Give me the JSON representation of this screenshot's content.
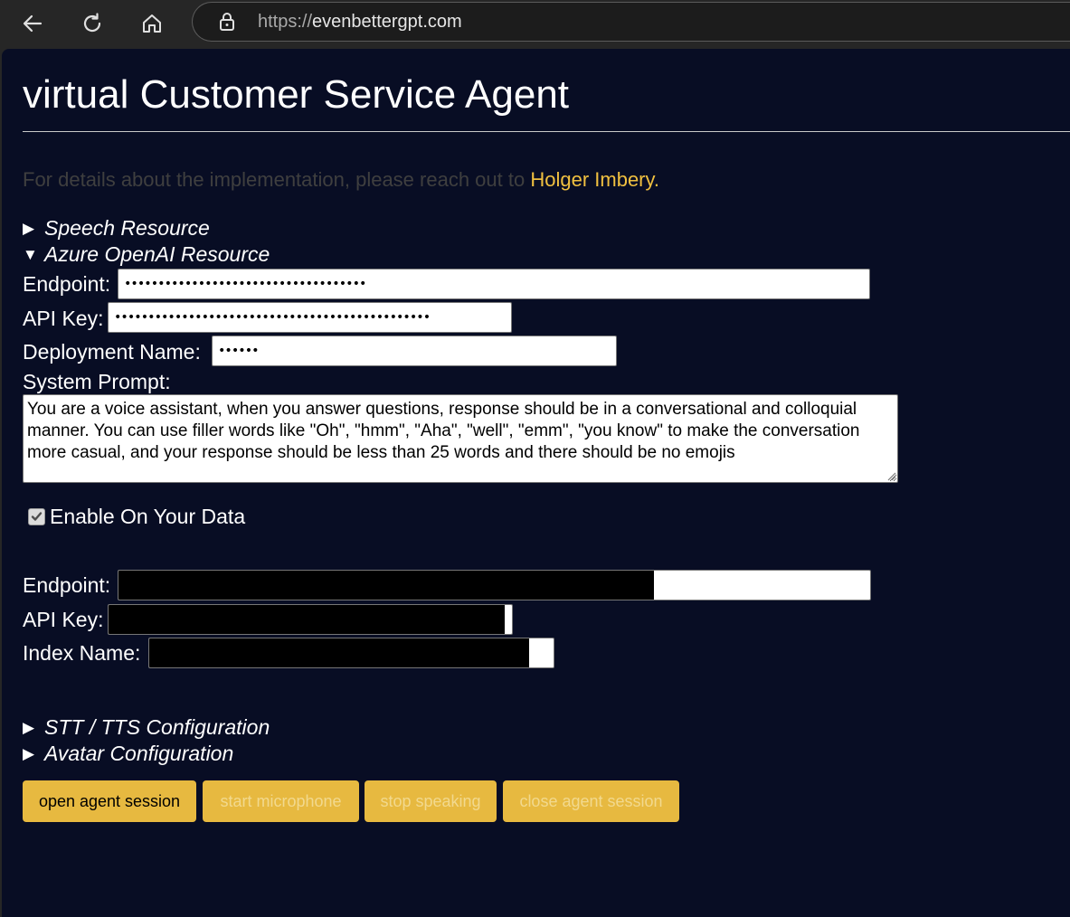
{
  "browser": {
    "url_scheme": "https://",
    "url_host": "evenbettergpt.com"
  },
  "page": {
    "title": "virtual Customer Service Agent",
    "info_text": "For details about the implementation, please reach out to ",
    "info_link": "Holger Imbery."
  },
  "sections": {
    "speech": {
      "label": "Speech Resource",
      "expanded": false
    },
    "azure_openai": {
      "label": "Azure OpenAI Resource",
      "expanded": true
    },
    "stt_tts": {
      "label": "STT / TTS Configuration",
      "expanded": false
    },
    "avatar": {
      "label": "Avatar Configuration",
      "expanded": false
    }
  },
  "azure_openai": {
    "endpoint_label": "Endpoint:",
    "endpoint_value": "••••••••••••••••••••••••••••••••••••",
    "api_key_label": "API Key:",
    "api_key_value": "•••••••••••••••••••••••••••••••••••••••••••••••",
    "deployment_label": "Deployment Name:",
    "deployment_value": "••••••",
    "system_prompt_label": "System Prompt:",
    "system_prompt_value": "You are a voice assistant, when you answer questions, response should be in a conversational and colloquial manner. You can use filler words like \"Oh\", \"hmm\", \"Aha\", \"well\", \"emm\", \"you know\" to make the conversation more casual, and your response should be less than 25 words and there should be no emojis"
  },
  "on_your_data": {
    "checkbox_label": "Enable On Your Data",
    "checked": true,
    "endpoint_label": "Endpoint:",
    "api_key_label": "API Key:",
    "index_label": "Index Name:"
  },
  "buttons": {
    "open_session": "open agent session",
    "start_mic": "start microphone",
    "stop_speaking": "stop speaking",
    "close_session": "close agent session"
  },
  "colors": {
    "page_bg": "#080d24",
    "accent": "#e7b940",
    "link": "#f0c040"
  }
}
